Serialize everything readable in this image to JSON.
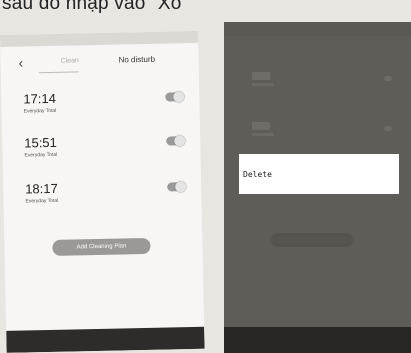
{
  "caption": "sau đó nhập vào \"Xo",
  "left_screen": {
    "nav": {
      "tab_clean": "Clean",
      "tab_no_disturb": "No disturb"
    },
    "plans": [
      {
        "time": "17:14",
        "repeat": "Everyday Total"
      },
      {
        "time": "15:51",
        "repeat": "Everyday Total"
      },
      {
        "time": "18:17",
        "repeat": "Everyday Total"
      }
    ],
    "add_button": "Add Cleaning Plan"
  },
  "right_screen": {
    "menu": {
      "delete_label": "Delete"
    }
  }
}
